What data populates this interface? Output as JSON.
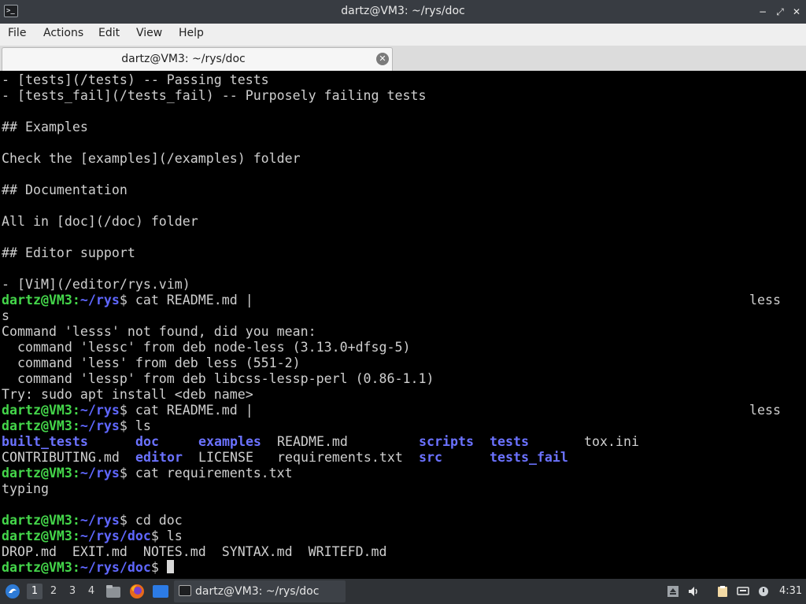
{
  "window": {
    "title": "dartz@VM3: ~/rys/doc",
    "app_icon_text": ">_",
    "buttons": {
      "minimize": "−",
      "maximize": "⤢",
      "close": "✕"
    }
  },
  "menu": [
    "File",
    "Actions",
    "Edit",
    "View",
    "Help"
  ],
  "tab": {
    "label": "dartz@VM3: ~/rys/doc",
    "close_glyph": "✕"
  },
  "terminal": {
    "prompt_user": "dartz@VM3:",
    "lines": [
      "- [tests](/tests) -- Passing tests",
      "- [tests_fail](/tests_fail) -- Purposely failing tests",
      "",
      "## Examples",
      "",
      "Check the [examples](/examples) folder",
      "",
      "## Documentation",
      "",
      "All in [doc](/doc) folder",
      "",
      "## Editor support",
      "",
      "- [ViM](/editor/rys.vim)"
    ],
    "cmd1": {
      "path": "~/rys",
      "suffix": "$ cat README.md |",
      "wrap_right": "less",
      "wrap_next": "s"
    },
    "error_lines": [
      "Command 'lesss' not found, did you mean:",
      "  command 'lessc' from deb node-less (3.13.0+dfsg-5)",
      "  command 'less' from deb less (551-2)",
      "  command 'lessp' from deb libcss-lessp-perl (0.86-1.1)",
      "Try: sudo apt install <deb name>"
    ],
    "cmd2": {
      "path": "~/rys",
      "suffix": "$ cat README.md |",
      "wrap_right": "less"
    },
    "cmd3": {
      "path": "~/rys",
      "suffix": "$ ls"
    },
    "ls_row1": [
      "built_tests",
      "doc",
      "examples",
      "README.md",
      "scripts",
      "tests",
      "tox.ini"
    ],
    "ls_row2": [
      "CONTRIBUTING.md",
      "editor",
      "LICENSE",
      "requirements.txt",
      "src",
      "tests_fail"
    ],
    "cmd4": {
      "path": "~/rys",
      "suffix": "$ cat requirements.txt"
    },
    "req_output": "typing",
    "cmd5": {
      "path": "~/rys",
      "suffix": "$ cd doc"
    },
    "cmd6": {
      "path": "~/rys/doc",
      "suffix": "$ ls"
    },
    "doc_ls": "DROP.md  EXIT.md  NOTES.md  SYNTAX.md  WRITEFD.md",
    "cmd7": {
      "path": "~/rys/doc",
      "suffix": "$ "
    }
  },
  "taskbar": {
    "workspaces": [
      "1",
      "2",
      "3",
      "4"
    ],
    "task_label": "dartz@VM3: ~/rys/doc",
    "clock": "4:31"
  },
  "colors": {
    "prompt": "#44d64a",
    "dir": "#6b72ff",
    "bg": "#000000"
  }
}
